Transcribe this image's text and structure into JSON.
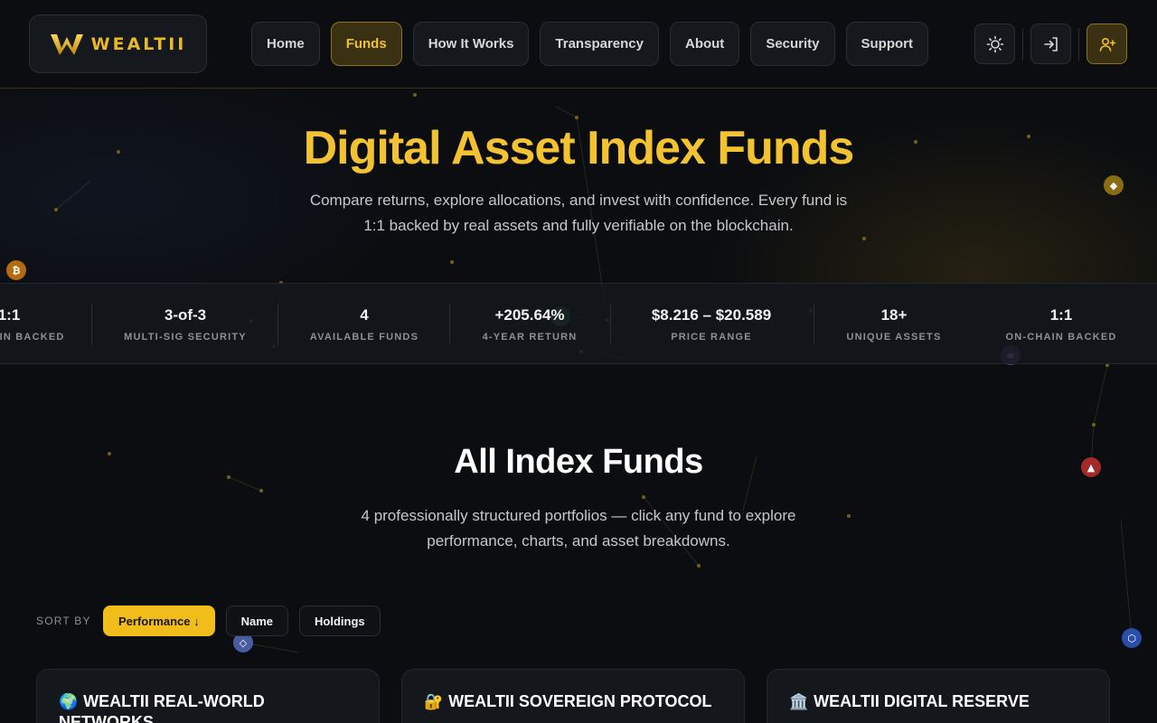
{
  "brand": {
    "name": "WEALTII"
  },
  "nav": {
    "items": [
      {
        "label": "Home"
      },
      {
        "label": "Funds"
      },
      {
        "label": "How It Works"
      },
      {
        "label": "Transparency"
      },
      {
        "label": "About"
      },
      {
        "label": "Security"
      },
      {
        "label": "Support"
      }
    ],
    "active": "Funds"
  },
  "header_icons": [
    "sun-icon",
    "sign-in-icon",
    "user-plus-icon"
  ],
  "hero": {
    "title": "Digital Asset Index Funds",
    "subtitle": "Compare returns, explore allocations, and invest with confidence. Every fund is 1:1 backed by real assets and fully verifiable on the blockchain."
  },
  "stats": {
    "items": [
      {
        "value": "1:1",
        "label": "ON-CHAIN BACKED"
      },
      {
        "value": "3-of-3",
        "label": "MULTI-SIG SECURITY"
      },
      {
        "value": "4",
        "label": "AVAILABLE FUNDS"
      },
      {
        "value": "+205.64%",
        "label": "4-YEAR RETURN"
      },
      {
        "value": "$8.216 – $20.589",
        "label": "PRICE RANGE"
      },
      {
        "value": "18+",
        "label": "UNIQUE ASSETS"
      },
      {
        "value": "1:1",
        "label": "ON-CHAIN BACKED"
      }
    ]
  },
  "funds_section": {
    "title": "All Index Funds",
    "subtitle": "4 professionally structured portfolios — click any fund to explore performance, charts, and asset breakdowns."
  },
  "sort": {
    "label": "SORT BY",
    "options": [
      {
        "label": "Performance ↓"
      },
      {
        "label": "Name"
      },
      {
        "label": "Holdings"
      }
    ],
    "active": "Performance ↓"
  },
  "funds": [
    {
      "icon": "🌍",
      "name": "WEALTII REAL-WORLD NETWORKS"
    },
    {
      "icon": "🔐",
      "name": "WEALTII SOVEREIGN PROTOCOL"
    },
    {
      "icon": "🏛️",
      "name": "WEALTII DIGITAL RESERVE"
    }
  ],
  "colors": {
    "accent": "#f0bd1a",
    "background": "#0b0d10",
    "card": "#14171b"
  }
}
